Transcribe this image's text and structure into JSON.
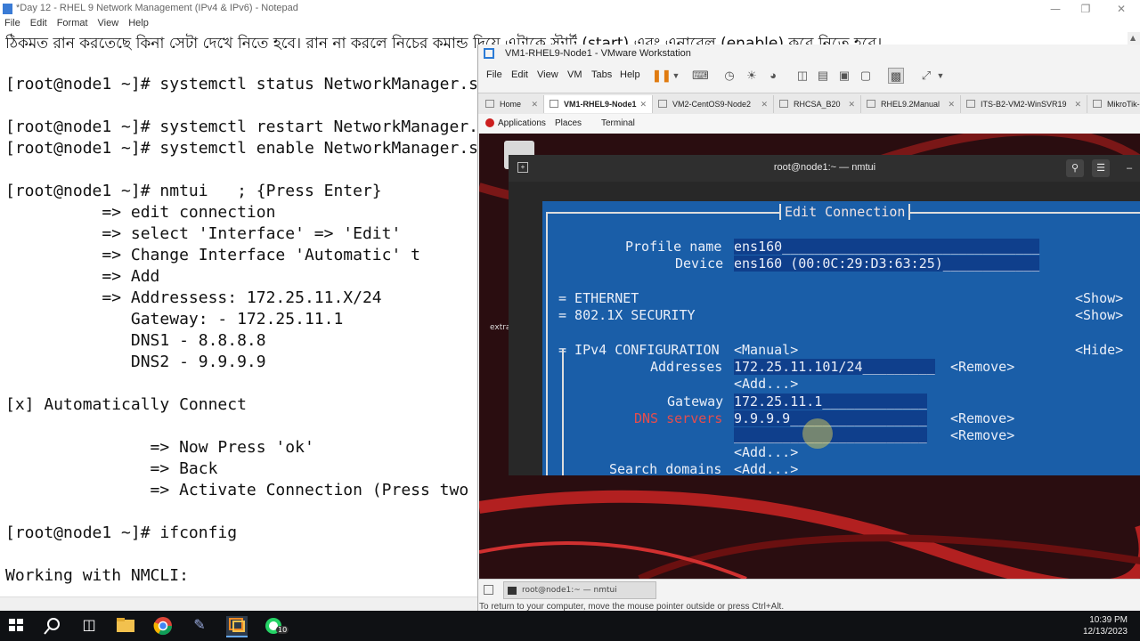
{
  "notepad": {
    "title": "*Day 12 - RHEL 9 Network Management (IPv4 & IPv6) - Notepad",
    "menu": [
      "File",
      "Edit",
      "Format",
      "View",
      "Help"
    ],
    "bengali_line": "ঠিকমত রান করতেছে কিনা সেটা দেখে নিতে হবে। রান না করলে নিচের কমান্ড দিয়ে এটাকে স্টার্ট (start) এবং এনাবেল (enable) করে নিতে হবে।",
    "lines": [
      "[root@node1 ~]# systemctl status NetworkManager.se",
      "[root@node1 ~]# systemctl restart NetworkManager.s",
      "[root@node1 ~]# systemctl enable NetworkManager.se",
      "[root@node1 ~]# nmtui   ; {Press Enter}",
      "          => edit connection",
      "          => select 'Interface' => 'Edit'",
      "          => Change Interface 'Automatic' t",
      "          => Add",
      "          => Addressess: 172.25.11.X/24",
      "             Gateway: - 172.25.11.1",
      "             DNS1 - 8.8.8.8",
      "             DNS2 - 9.9.9.9",
      "[x] Automatically Connect",
      "               => Now Press 'ok'",
      "               => Back",
      "               => Activate Connection (Press two",
      "[root@node1 ~]# ifconfig",
      "Working with NMCLI:"
    ]
  },
  "vmware": {
    "title": "VM1-RHEL9-Node1 - VMware Workstation",
    "menu": [
      "File",
      "Edit",
      "View",
      "VM",
      "Tabs",
      "Help"
    ],
    "tabs": [
      {
        "label": "Home",
        "active": false
      },
      {
        "label": "VM1-RHEL9-Node1",
        "active": true
      },
      {
        "label": "VM2-CentOS9-Node2",
        "active": false
      },
      {
        "label": "RHCSA_B20",
        "active": false
      },
      {
        "label": "RHEL9.2Manual",
        "active": false
      },
      {
        "label": "ITS-B2-VM2-WinSVR19",
        "active": false
      },
      {
        "label": "MikroTik-",
        "active": false
      }
    ],
    "gnome": {
      "applications": "Applications",
      "places": "Places",
      "terminal": "Terminal"
    },
    "desktop_label": "extra",
    "status_tab": "root@node1:~ — nmtui",
    "hint": "To return to your computer, move the mouse pointer outside or press Ctrl+Alt."
  },
  "terminal": {
    "title": "root@node1:~ — nmtui"
  },
  "nmtui": {
    "header": "Edit Connection",
    "profile_label": "Profile name",
    "profile_value": "ens160________________________________",
    "device_label": "Device",
    "device_value": "ens160 (00:0C:29:D3:63:25)____________",
    "ethernet": "= ETHERNET",
    "security": "= 802.1X SECURITY",
    "show": "<Show>",
    "ipv4": "= IPv4 CONFIGURATION",
    "manual": "<Manual>",
    "hide": "<Hide>",
    "addresses_label": "Addresses",
    "address_value": "172.25.11.101/24_________",
    "remove": "<Remove>",
    "add": "<Add...>",
    "gateway_label": "Gateway",
    "gateway_value": "172.25.11.1_____________",
    "dns_label": "DNS servers",
    "dns_value_1": "9.9.9.9_________________",
    "dns_value_2": "________________________",
    "search_label": "Search domains"
  },
  "taskbar": {
    "time": "10:39 PM",
    "date": "12/13/2023",
    "whatsapp_badge": "10"
  }
}
